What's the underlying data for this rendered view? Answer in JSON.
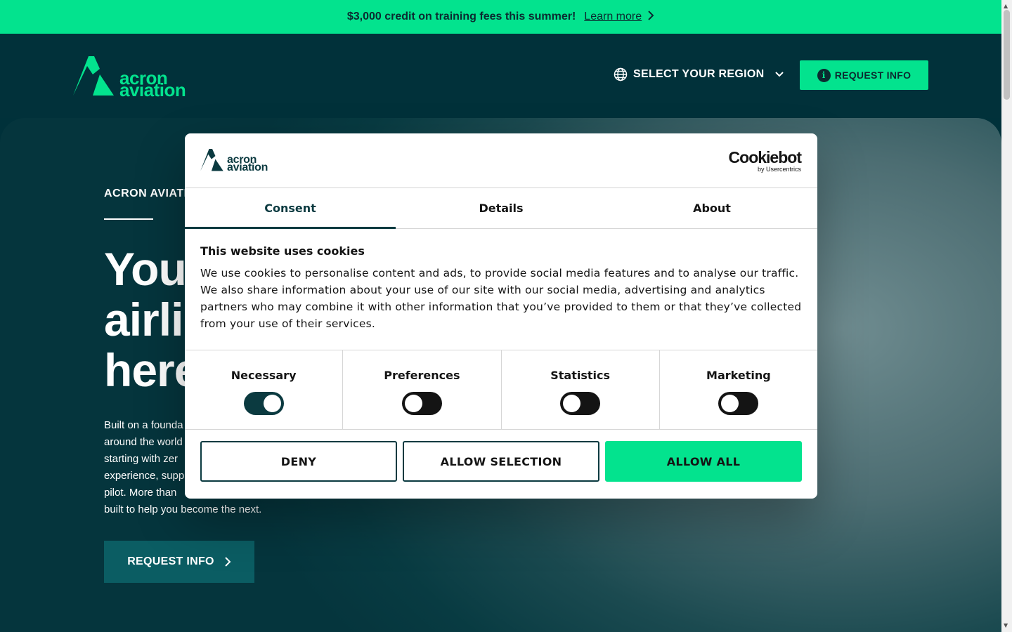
{
  "announcement": {
    "text": "$3,000 credit on training fees this summer!",
    "link": "Learn more",
    "icon": "chevron-right-icon"
  },
  "header": {
    "logo_line1": "acron",
    "logo_line2": "aviation",
    "region_label": "SELECT YOUR REGION",
    "request_info": "REQUEST INFO"
  },
  "hero": {
    "eyebrow": "ACRON AVIATI",
    "title_lines": [
      "Your",
      "airlin",
      "here"
    ],
    "body_lines": [
      "Built on a founda",
      "around the world",
      "starting with zer",
      "experience, supp",
      "pilot. More than",
      "built to help you become the next."
    ],
    "cta": "REQUEST INFO"
  },
  "cookie_dialog": {
    "logo_line1": "acron",
    "logo_line2": "aviation",
    "brand_name": "Cookiebot",
    "brand_sub": "by Usercentrics",
    "tabs": [
      {
        "label": "Consent",
        "active": true
      },
      {
        "label": "Details",
        "active": false
      },
      {
        "label": "About",
        "active": false
      }
    ],
    "heading": "This website uses cookies",
    "body": "We use cookies to personalise content and ads, to provide social media features and to analyse our traffic. We also share information about your use of our site with our social media, advertising and analytics partners who may combine it with other information that you’ve provided to them or that they’ve collected from your use of their services.",
    "categories": [
      {
        "label": "Necessary",
        "enabled": true
      },
      {
        "label": "Preferences",
        "enabled": false
      },
      {
        "label": "Statistics",
        "enabled": false
      },
      {
        "label": "Marketing",
        "enabled": false
      }
    ],
    "buttons": {
      "deny": "DENY",
      "allow_selection": "ALLOW SELECTION",
      "allow_all": "ALLOW ALL"
    }
  },
  "colors": {
    "accent": "#03e38e",
    "dark_teal": "#00313a",
    "cta_teal": "#0b5d63"
  }
}
